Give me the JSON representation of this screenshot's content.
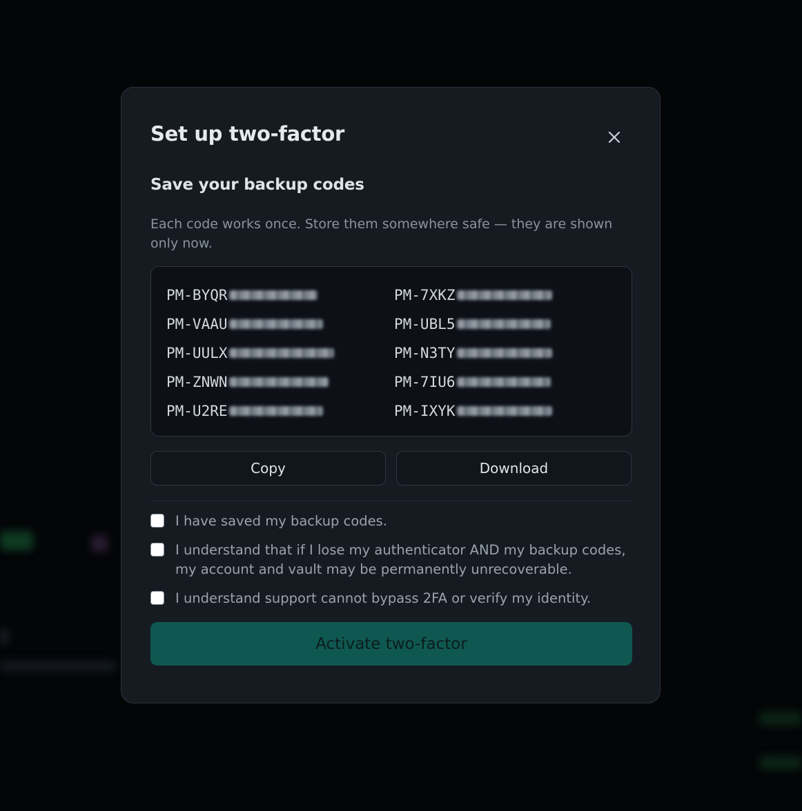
{
  "modal": {
    "title": "Set up two-factor",
    "close_icon": "close-icon",
    "section_title": "Save your backup codes",
    "description": "Each code works once. Store them somewhere safe — they are shown only now.",
    "codes": [
      "PM-BYQR",
      "PM-7XKZ",
      "PM-VAAU",
      "PM-UBL5",
      "PM-UULX",
      "PM-N3TY",
      "PM-ZNWN",
      "PM-7IU6",
      "PM-U2RE",
      "PM-IXYK"
    ],
    "copy_label": "Copy",
    "download_label": "Download",
    "checks": [
      "I have saved my backup codes.",
      "I understand that if I lose my authenticator AND my backup codes, my account and vault may be permanently unrecoverable.",
      "I understand support cannot bypass 2FA or verify my identity."
    ],
    "activate_label": "Activate two-factor"
  },
  "colors": {
    "accent": "#0f5851",
    "surface": "#161b22",
    "backdrop": "#030507"
  }
}
